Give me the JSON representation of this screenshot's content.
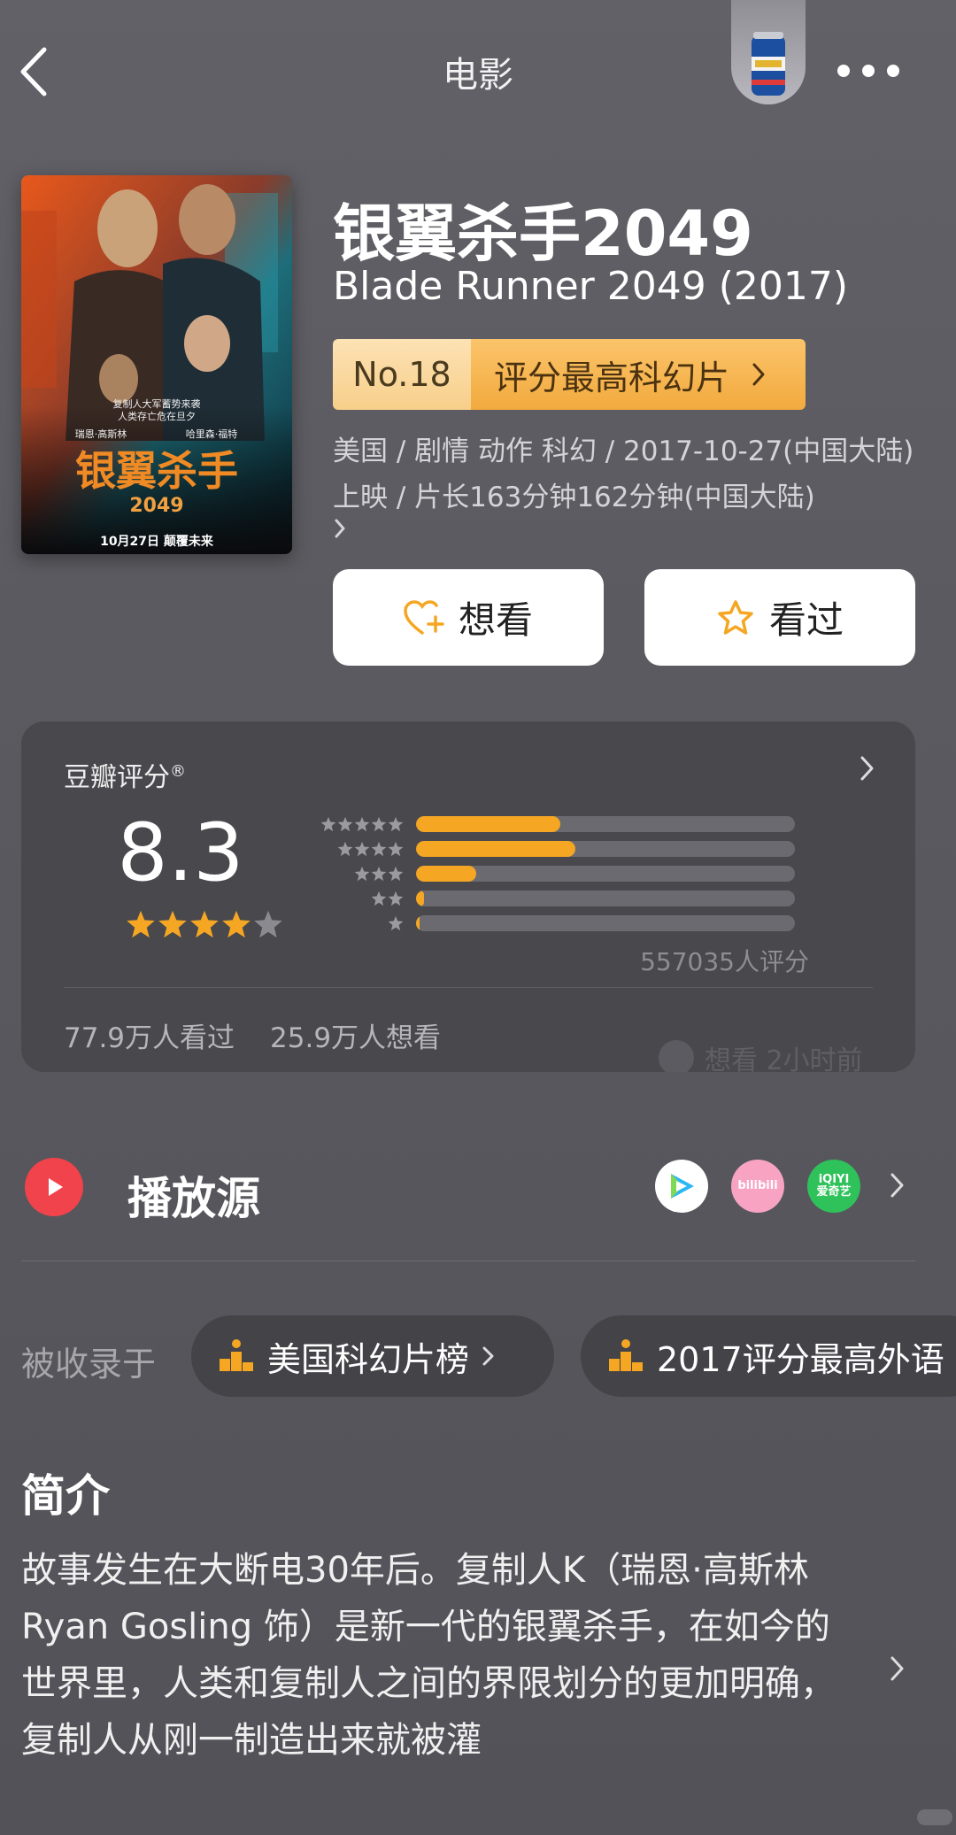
{
  "nav": {
    "title": "电影"
  },
  "movie": {
    "title_cn": "银翼杀手2049",
    "title_en": "Blade Runner 2049 (2017)",
    "rank_no": "No.18",
    "rank_label": "评分最高科幻片",
    "meta": "美国 / 剧情 动作 科幻 / 2017-10-27(中国大陆)上映 / 片长163分钟162分钟(中国大陆)",
    "poster": {
      "tagline_1": "复制人大军蓄势来袭",
      "tagline_2": "人类存亡危在旦夕",
      "actor_1": "瑞恩·高斯林",
      "actor_2": "哈里森·福特",
      "title": "银翼杀手",
      "year": "2049",
      "release": "10月27日 颠覆未来"
    }
  },
  "actions": {
    "want_label": "想看",
    "seen_label": "看过"
  },
  "rating": {
    "header": "豆瓣评分",
    "header_mark": "®",
    "score": "8.3",
    "stars_filled": 4,
    "distribution": [
      {
        "stars": 5,
        "fraction": 0.38
      },
      {
        "stars": 4,
        "fraction": 0.42
      },
      {
        "stars": 3,
        "fraction": 0.16
      },
      {
        "stars": 2,
        "fraction": 0.02
      },
      {
        "stars": 1,
        "fraction": 0.005
      }
    ],
    "votes": "557035人评分",
    "seen_count": "77.9万人看过",
    "want_count": "25.9万人想看",
    "ghost_note": "想看  2小时前"
  },
  "play_source": {
    "label": "播放源",
    "platforms": [
      "tencent-video",
      "bilibili",
      "iQIYI 爱奇艺"
    ],
    "bili_text": "bilibili",
    "iqiyi_text": "iQIYI",
    "iqiyi_cn": "爱奇艺"
  },
  "collected": {
    "label": "被收录于",
    "chips": [
      "美国科幻片榜",
      "2017评分最高外语"
    ]
  },
  "intro": {
    "title": "简介",
    "text": "故事发生在大断电30年后。复制人K（瑞恩·高斯林 Ryan Gosling 饰）是新一代的银翼杀手，在如今的世界里，人类和复制人之间的界限划分的更加明确，复制人从刚一制造出来就被灌"
  },
  "colors": {
    "accent": "#f5a623",
    "play": "#f0434b",
    "background": "#58585e"
  }
}
